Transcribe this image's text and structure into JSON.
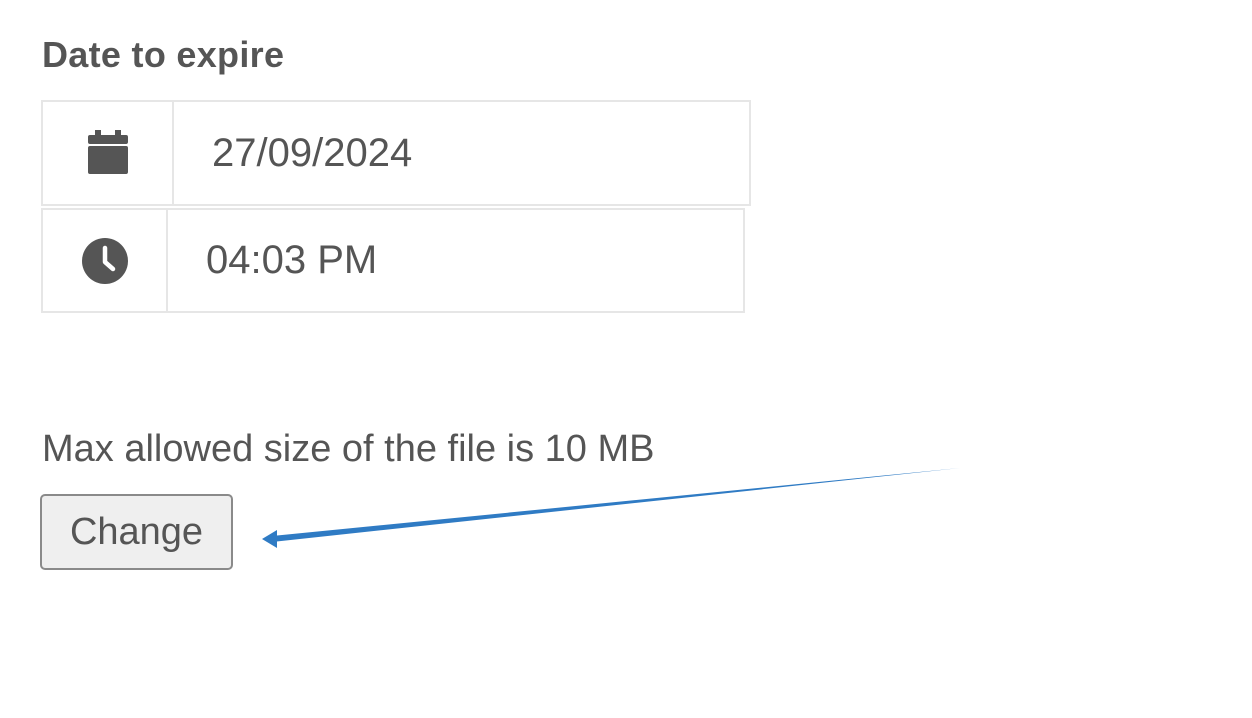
{
  "expiry": {
    "title": "Date to expire",
    "date": {
      "icon": "calendar-icon",
      "value": "27/09/2024"
    },
    "time": {
      "icon": "clock-icon",
      "value": "04:03 PM"
    }
  },
  "upload": {
    "size_note": "Max allowed size of the file is 10 MB",
    "change_label": "Change"
  },
  "annotation": {
    "arrow_color": "#2f7bc4",
    "points_to": "change-button"
  }
}
